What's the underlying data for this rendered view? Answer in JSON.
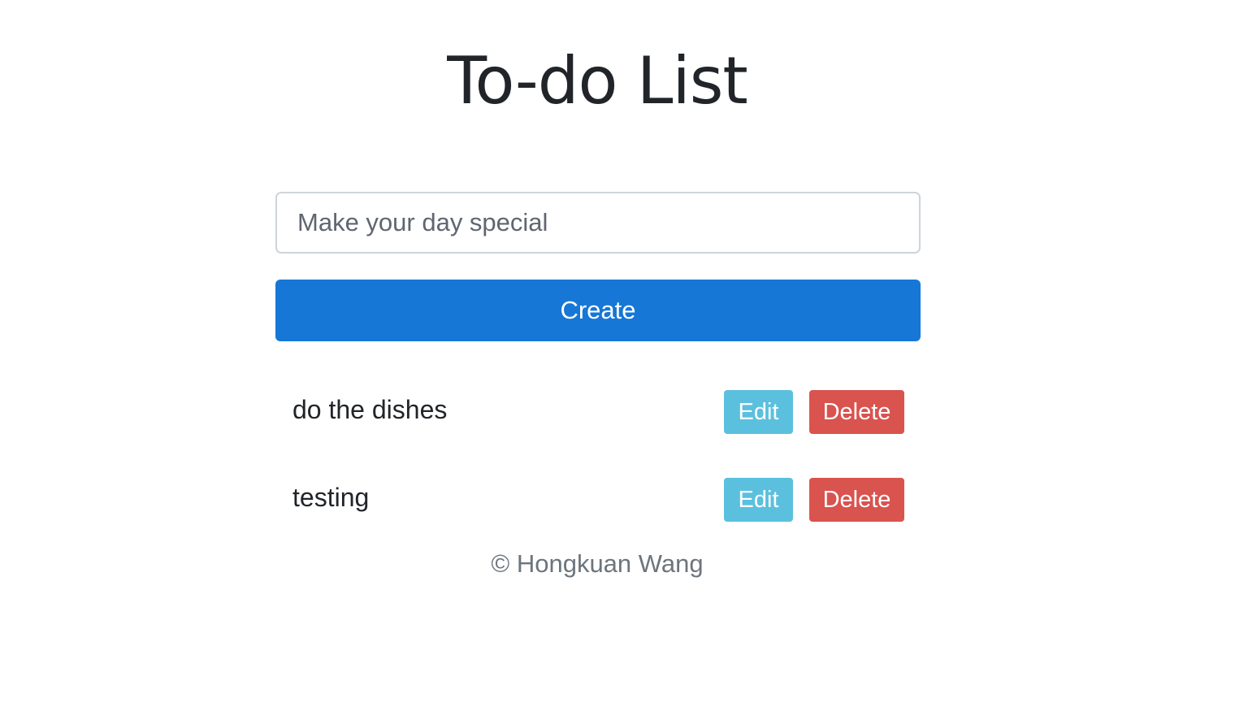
{
  "page": {
    "title": "To-do List"
  },
  "form": {
    "input_value": "",
    "input_placeholder": "Make your day special",
    "create_label": "Create"
  },
  "todos": [
    {
      "text": "do the dishes",
      "edit_label": "Edit",
      "delete_label": "Delete"
    },
    {
      "text": "testing",
      "edit_label": "Edit",
      "delete_label": "Delete"
    }
  ],
  "footer": {
    "text": "© Hongkuan Wang"
  },
  "colors": {
    "primary": "#1677d6",
    "info": "#5bc0de",
    "danger": "#d9534f",
    "text": "#212529",
    "muted": "#6c757d"
  }
}
